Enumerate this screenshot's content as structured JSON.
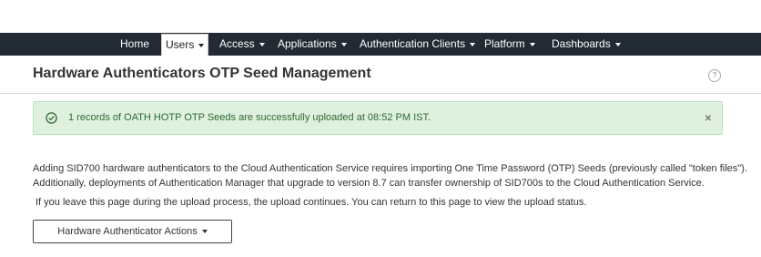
{
  "nav": {
    "items": [
      {
        "label": "Home",
        "dropdown": false
      },
      {
        "label": "Users",
        "dropdown": true,
        "active": true
      },
      {
        "label": "Access",
        "dropdown": true
      },
      {
        "label": "Applications",
        "dropdown": true
      },
      {
        "label": "Authentication Clients",
        "dropdown": true
      },
      {
        "label": "Platform",
        "dropdown": true
      },
      {
        "label": "Dashboards",
        "dropdown": true
      }
    ]
  },
  "page": {
    "title": "Hardware Authenticators OTP Seed Management",
    "help": "?"
  },
  "alert": {
    "message": "1 records of OATH HOTP OTP Seeds are successfully uploaded at 08:52 PM IST.",
    "close": "×",
    "icon": "check-circle-icon",
    "color": "#2d6a32"
  },
  "body": {
    "line1": "Adding SID700 hardware authenticators to the Cloud Authentication Service requires importing One Time Password (OTP) Seeds (previously called \"token files\").",
    "line2": "Additionally, deployments of Authentication Manager that upgrade to version 8.7 can transfer ownership of SID700s to the Cloud Authentication Service.",
    "line3": "If you leave this page during the upload process, the upload continues. You can return to this page to view the upload status."
  },
  "actions": {
    "label": "Hardware Authenticator Actions"
  }
}
